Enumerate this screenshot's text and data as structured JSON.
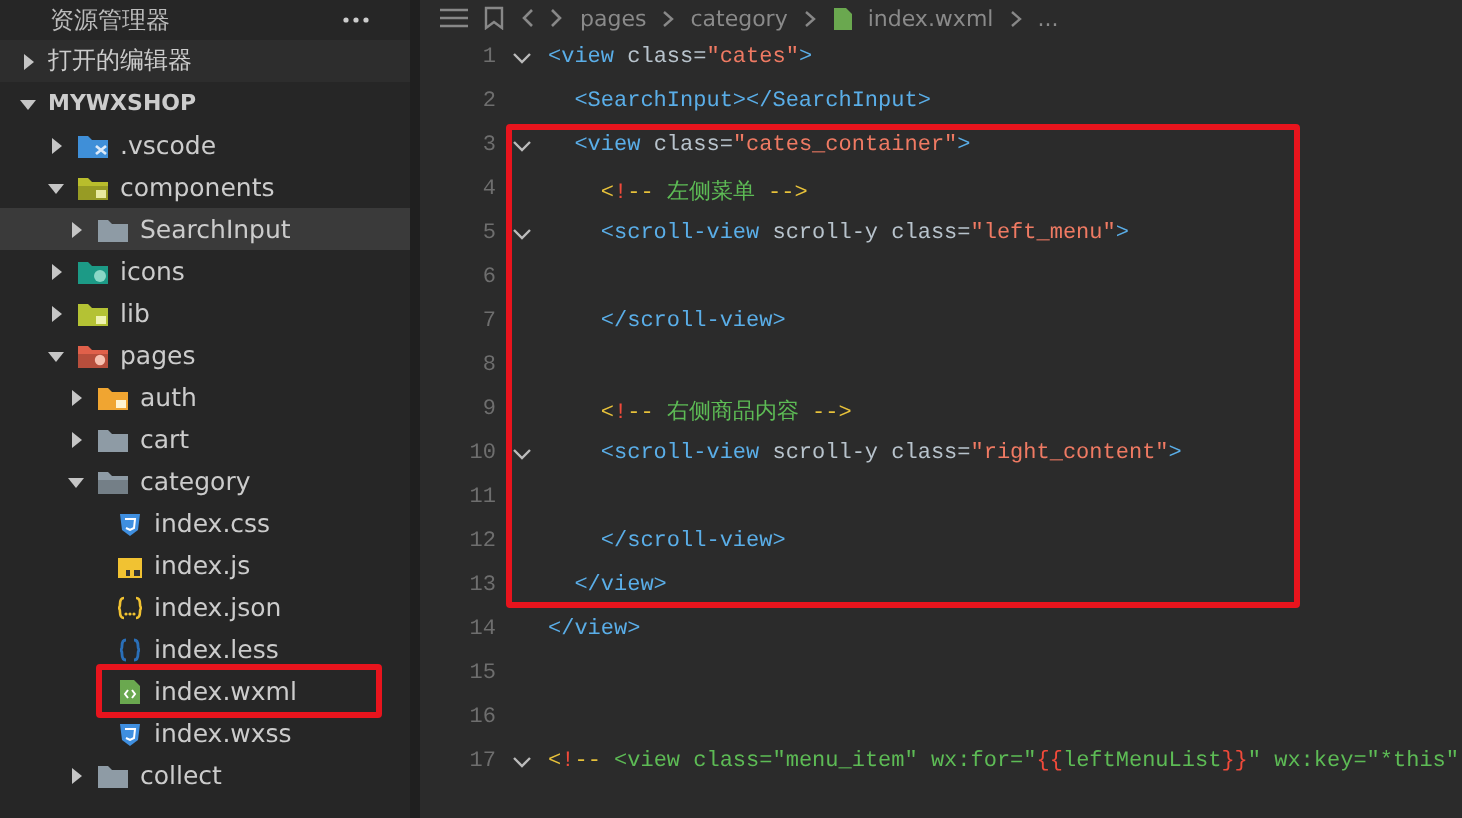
{
  "sidebar": {
    "title": "资源管理器",
    "sections": [
      {
        "label": "打开的编辑器",
        "expanded": false
      },
      {
        "label": "MYWXSHOP",
        "expanded": true,
        "items": [
          {
            "name": ".vscode",
            "kind": "vscode",
            "expanded": false,
            "selected": false,
            "highlighted": false
          },
          {
            "name": "components",
            "kind": "components",
            "expanded": true,
            "selected": false,
            "highlighted": false,
            "children": [
              {
                "name": "SearchInput",
                "kind": "folder",
                "expanded": false,
                "selected": true,
                "highlighted": false
              }
            ]
          },
          {
            "name": "icons",
            "kind": "images",
            "expanded": false,
            "selected": false,
            "highlighted": false
          },
          {
            "name": "lib",
            "kind": "lib",
            "expanded": false,
            "selected": false,
            "highlighted": false
          },
          {
            "name": "pages",
            "kind": "pages",
            "expanded": true,
            "selected": false,
            "highlighted": false,
            "children": [
              {
                "name": "auth",
                "kind": "locked",
                "expanded": false,
                "selected": false,
                "highlighted": false
              },
              {
                "name": "cart",
                "kind": "folder",
                "expanded": false,
                "selected": false,
                "highlighted": false
              },
              {
                "name": "category",
                "kind": "folder",
                "expanded": true,
                "selected": false,
                "highlighted": false,
                "children": [
                  {
                    "name": "index.css",
                    "kind": "css",
                    "selected": false,
                    "highlighted": false
                  },
                  {
                    "name": "index.js",
                    "kind": "js",
                    "selected": false,
                    "highlighted": false
                  },
                  {
                    "name": "index.json",
                    "kind": "json",
                    "selected": false,
                    "highlighted": false
                  },
                  {
                    "name": "index.less",
                    "kind": "less",
                    "selected": false,
                    "highlighted": false
                  },
                  {
                    "name": "index.wxml",
                    "kind": "wxml",
                    "selected": false,
                    "highlighted": true
                  },
                  {
                    "name": "index.wxss",
                    "kind": "css",
                    "selected": false,
                    "highlighted": false
                  }
                ]
              },
              {
                "name": "collect",
                "kind": "folder",
                "expanded": false,
                "selected": false,
                "highlighted": false
              }
            ]
          }
        ]
      }
    ]
  },
  "breadcrumb": {
    "parts": [
      "pages",
      "category",
      "index.wxml"
    ],
    "more": "..."
  },
  "editor": {
    "lines": [
      {
        "number": "1",
        "fold": true,
        "boxed": false,
        "tokens": [
          {
            "kind": "tag",
            "text": "<view"
          },
          {
            "kind": "attr",
            "text": " class="
          },
          {
            "kind": "str",
            "text": "\"cates\""
          },
          {
            "kind": "tag",
            "text": ">"
          }
        ]
      },
      {
        "number": "2",
        "fold": false,
        "boxed": false,
        "tokens": [
          {
            "kind": "tag",
            "text": "  <SearchInput></SearchInput>"
          }
        ]
      },
      {
        "number": "3",
        "fold": true,
        "boxed": true,
        "tokens": [
          {
            "kind": "tag",
            "text": "  <view"
          },
          {
            "kind": "attr",
            "text": " class="
          },
          {
            "kind": "str",
            "text": "\"cates_container\""
          },
          {
            "kind": "tag",
            "text": ">"
          }
        ]
      },
      {
        "number": "4",
        "fold": false,
        "boxed": true,
        "tokens": [
          {
            "kind": "mark",
            "text": "    <"
          },
          {
            "kind": "bang",
            "text": "!"
          },
          {
            "kind": "mark",
            "text": "--"
          },
          {
            "kind": "cmt",
            "text": " 左侧菜单 "
          },
          {
            "kind": "mark",
            "text": "-->"
          }
        ]
      },
      {
        "number": "5",
        "fold": true,
        "boxed": true,
        "tokens": [
          {
            "kind": "tag",
            "text": "    <scroll-view"
          },
          {
            "kind": "attr",
            "text": " scroll-y class="
          },
          {
            "kind": "str",
            "text": "\"left_menu\""
          },
          {
            "kind": "tag",
            "text": ">"
          }
        ]
      },
      {
        "number": "6",
        "fold": false,
        "boxed": true
      },
      {
        "number": "7",
        "fold": false,
        "boxed": true,
        "tokens": [
          {
            "kind": "tag",
            "text": "    </scroll-view>"
          }
        ]
      },
      {
        "number": "8",
        "fold": false,
        "boxed": true
      },
      {
        "number": "9",
        "fold": false,
        "boxed": true,
        "tokens": [
          {
            "kind": "mark",
            "text": "    <"
          },
          {
            "kind": "bang",
            "text": "!"
          },
          {
            "kind": "mark",
            "text": "--"
          },
          {
            "kind": "cmt",
            "text": " 右侧商品内容 "
          },
          {
            "kind": "mark",
            "text": "-->"
          }
        ]
      },
      {
        "number": "10",
        "fold": true,
        "boxed": true,
        "tokens": [
          {
            "kind": "tag",
            "text": "    <scroll-view"
          },
          {
            "kind": "attr",
            "text": " scroll-y class="
          },
          {
            "kind": "str",
            "text": "\"right_content\""
          },
          {
            "kind": "tag",
            "text": ">"
          }
        ]
      },
      {
        "number": "11",
        "fold": false,
        "boxed": true
      },
      {
        "number": "12",
        "fold": false,
        "boxed": true,
        "tokens": [
          {
            "kind": "tag",
            "text": "    </scroll-view>"
          }
        ]
      },
      {
        "number": "13",
        "fold": false,
        "boxed": true,
        "tokens": [
          {
            "kind": "tag",
            "text": "  </view>"
          }
        ]
      },
      {
        "number": "14",
        "fold": false,
        "boxed": false,
        "tokens": [
          {
            "kind": "tag",
            "text": "</view>"
          }
        ]
      },
      {
        "number": "15",
        "fold": false,
        "boxed": false
      },
      {
        "number": "16",
        "fold": false,
        "boxed": false
      },
      {
        "number": "17",
        "fold": true,
        "boxed": false,
        "tokens": [
          {
            "kind": "mark",
            "text": "<"
          },
          {
            "kind": "bang",
            "text": "!"
          },
          {
            "kind": "mark",
            "text": "--"
          },
          {
            "kind": "cmt",
            "text": " <view class=\"menu_item\" wx:for=\""
          },
          {
            "kind": "bang",
            "text": "{{"
          },
          {
            "kind": "cmt",
            "text": "leftMenuList"
          },
          {
            "kind": "bang",
            "text": "}}"
          },
          {
            "kind": "cmt",
            "text": "\" wx:key=\"*this\""
          }
        ]
      }
    ]
  }
}
